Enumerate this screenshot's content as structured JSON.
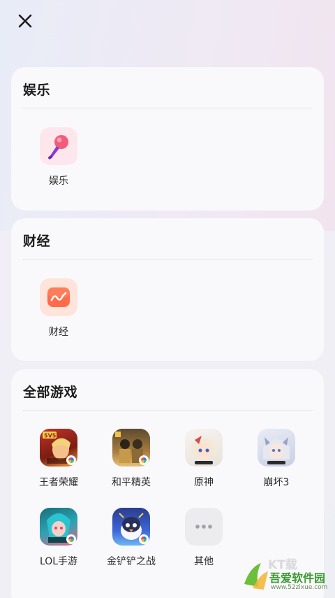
{
  "close_icon": "close-icon",
  "sections": {
    "entertainment": {
      "title": "娱乐",
      "items": [
        {
          "label": "娱乐",
          "icon": "microphone-icon"
        }
      ]
    },
    "finance": {
      "title": "财经",
      "items": [
        {
          "label": "财经",
          "icon": "chart-wave-icon"
        }
      ]
    },
    "games": {
      "title": "全部游戏",
      "items": [
        {
          "label": "王者荣耀",
          "icon": "honor-of-kings-icon"
        },
        {
          "label": "和平精英",
          "icon": "game-for-peace-icon"
        },
        {
          "label": "原神",
          "icon": "genshin-icon"
        },
        {
          "label": "崩坏3",
          "icon": "honkai3-icon"
        },
        {
          "label": "LOL手游",
          "icon": "lol-mobile-icon"
        },
        {
          "label": "金铲铲之战",
          "icon": "golden-spatula-icon"
        },
        {
          "label": "其他",
          "icon": "more-dots-icon"
        }
      ]
    }
  },
  "watermark": {
    "title": "吾爱软件园",
    "url": "www.52zixue.com"
  },
  "colors": {
    "accent_pink": "#f35b7a",
    "finance_orange": "#ff6a4a",
    "card_bg": "#fafafc"
  }
}
